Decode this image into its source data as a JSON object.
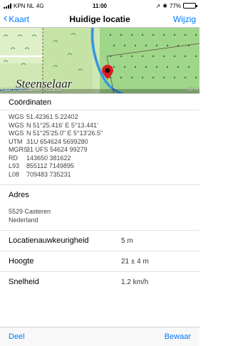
{
  "status_bar": {
    "carrier": "KPN NL",
    "network": "4G",
    "time": "11:00",
    "battery": "77%",
    "battery_level": 0.77
  },
  "nav": {
    "back_label": "Kaart",
    "title": "Huidige locatie",
    "edit_label": "Wijzig",
    "accent_color": "#007aff"
  },
  "map": {
    "place_label": "Steenselaar",
    "copyright": "Kaart © Top25raster © Kadaster",
    "scale": "200 m",
    "marker_icon": "location-pin-icon"
  },
  "coordinates": {
    "title": "Coördinaten",
    "rows": [
      {
        "label": "WGS",
        "value": "51.42361 5.22402"
      },
      {
        "label": "WGS",
        "value": "N 51°25.416' E 5°13.441'"
      },
      {
        "label": "WGS",
        "value": "N 51°25'25.0\" E 5°13'26.5\""
      },
      {
        "label": "UTM",
        "value": "31U 654624 5699280"
      },
      {
        "label": "MGRS",
        "value": "31 UFS 54624 99279"
      },
      {
        "label": "RD",
        "value": "143650 381622"
      },
      {
        "label": "L93",
        "value": "855112 7149895"
      },
      {
        "label": "L08",
        "value": "709483 735231"
      }
    ]
  },
  "address": {
    "title": "Adres",
    "line1": "5529 Casteren",
    "line2": "Nederland"
  },
  "info": {
    "accuracy_label": "Locatienauwkeurigheid",
    "accuracy_value": "5 m",
    "altitude_label": "Hoogte",
    "altitude_value": "21 ± 4 m",
    "speed_label": "Snelheid",
    "speed_value": "1.2 km/h"
  },
  "toolbar": {
    "share_label": "Deel",
    "save_label": "Bewaar"
  }
}
